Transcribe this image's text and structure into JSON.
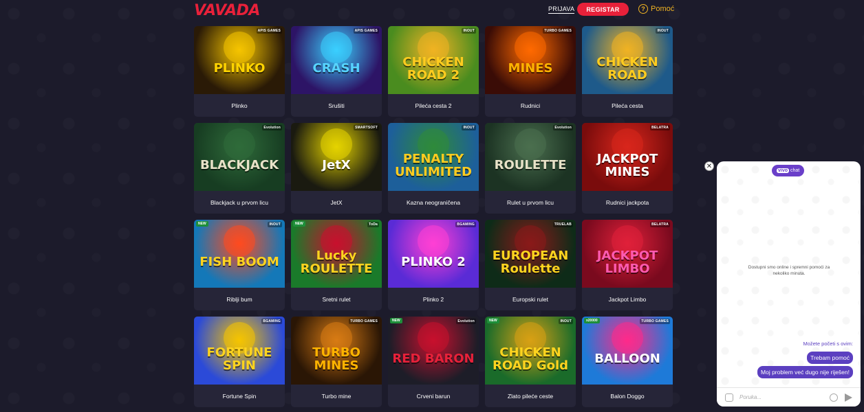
{
  "header": {
    "logo": "VAVADA",
    "login_label": "PRIJAVA",
    "register_label": "REGISTAR",
    "help_label": "Pomoć",
    "help_icon": "?"
  },
  "games": [
    {
      "title": "Plinko",
      "art": "PLINKO",
      "provider": "APIS GAMES",
      "new": "",
      "bg": "#2a1a06",
      "accent": "#f5c400",
      "text_color": "#ffd400"
    },
    {
      "title": "Srušiti",
      "art": "CRASH",
      "provider": "APIS GAMES",
      "new": "",
      "bg": "#2d1466",
      "accent": "#3ad0ff",
      "text_color": "#57d4ff"
    },
    {
      "title": "Pileća cesta 2",
      "art": "CHICKEN ROAD 2",
      "provider": "INOUT",
      "new": "",
      "bg": "#4a8c1f",
      "accent": "#f0b323",
      "text_color": "#ffcc1f"
    },
    {
      "title": "Rudnici",
      "art": "MINES",
      "provider": "TURBO GAMES",
      "new": "",
      "bg": "#3a0c06",
      "accent": "#ff6a00",
      "text_color": "#ffb300"
    },
    {
      "title": "Pileća cesta",
      "art": "CHICKEN ROAD",
      "provider": "INOUT",
      "new": "",
      "bg": "#1e5a8a",
      "accent": "#f0b323",
      "text_color": "#ffcc1f"
    },
    {
      "title": "Blackjack u prvom licu",
      "art": "BLACKJACK",
      "provider": "Evolution",
      "new": "",
      "bg": "#173d22",
      "accent": "#2f6b3a",
      "text_color": "#e8e2c8"
    },
    {
      "title": "JetX",
      "art": "JetX",
      "provider": "SMARTSOFT",
      "new": "",
      "bg": "#1a1a10",
      "accent": "#e5d400",
      "text_color": "#ffffff"
    },
    {
      "title": "Kazna neograničena",
      "art": "PENALTY UNLIMITED",
      "provider": "INOUT",
      "new": "",
      "bg": "#1d5f9a",
      "accent": "#2f8a3a",
      "text_color": "#ffcc1f"
    },
    {
      "title": "Rulet u prvom licu",
      "art": "ROULETTE",
      "provider": "Evolution",
      "new": "",
      "bg": "#1c3323",
      "accent": "#4b6f4f",
      "text_color": "#e8e2c8"
    },
    {
      "title": "Rudnici jackpota",
      "art": "JACKPOT MINES",
      "provider": "BELATRA",
      "new": "",
      "bg": "#7a0c0c",
      "accent": "#d8261c",
      "text_color": "#ffffff"
    },
    {
      "title": "Riblji bum",
      "art": "FISH BOOM",
      "provider": "INOUT",
      "new": "NEW",
      "bg": "#1478b8",
      "accent": "#ff4b1f",
      "text_color": "#ffd41f"
    },
    {
      "title": "Sretni rulet",
      "art": "Lucky ROULETTE",
      "provider": "ToDa",
      "new": "NEW",
      "bg": "#1a7a2a",
      "accent": "#c8102e",
      "text_color": "#ffd41f"
    },
    {
      "title": "Plinko 2",
      "art": "PLINKO 2",
      "provider": "BGAMING",
      "new": "",
      "bg": "#5a2bd6",
      "accent": "#ff3fd4",
      "text_color": "#ffffff"
    },
    {
      "title": "Europski rulet",
      "art": "EUROPEAN Roulette",
      "provider": "TRUELAB",
      "new": "",
      "bg": "#0e2b18",
      "accent": "#8a1a1a",
      "text_color": "#ffd41f"
    },
    {
      "title": "Jackpot Limbo",
      "art": "JACKPOT LIMBO",
      "provider": "BELATRA",
      "new": "",
      "bg": "#7a0a1e",
      "accent": "#e0203a",
      "text_color": "#ff5ab0"
    },
    {
      "title": "Fortune Spin",
      "art": "FORTUNE SPIN",
      "provider": "BGAMING",
      "new": "",
      "bg": "#2b4ad8",
      "accent": "#f5c400",
      "text_color": "#ffd41f"
    },
    {
      "title": "Turbo mine",
      "art": "TURBO MINES",
      "provider": "TURBO GAMES",
      "new": "",
      "bg": "#2a1605",
      "accent": "#d87b14",
      "text_color": "#ffb300"
    },
    {
      "title": "Crveni barun",
      "art": "RED BARON",
      "provider": "Evolution",
      "new": "NEW",
      "bg": "#1d1d28",
      "accent": "#c8102e",
      "text_color": "#e8213a"
    },
    {
      "title": "Zlato pileće ceste",
      "art": "CHICKEN ROAD Gold",
      "provider": "INOUT",
      "new": "NEW",
      "bg": "#1a6b2a",
      "accent": "#d8a014",
      "text_color": "#ffd41f"
    },
    {
      "title": "Balon Doggo",
      "art": "BALLOON",
      "provider": "TURBO GAMES",
      "new": "x20000",
      "bg": "#1e7ad8",
      "accent": "#ff2a8a",
      "text_color": "#ffffff"
    }
  ],
  "chat": {
    "brand_prefix": "vivo",
    "brand_suffix": "chat",
    "status_text": "Dostupni smo online i spremni pomoći za nekoliko minuta.",
    "start_label": "Možete početi s ovim:",
    "quick_reply_1": "Trebam pomoć",
    "quick_reply_2": "Moj problem već dugo nije riješen!",
    "input_placeholder": "Poruka..."
  }
}
